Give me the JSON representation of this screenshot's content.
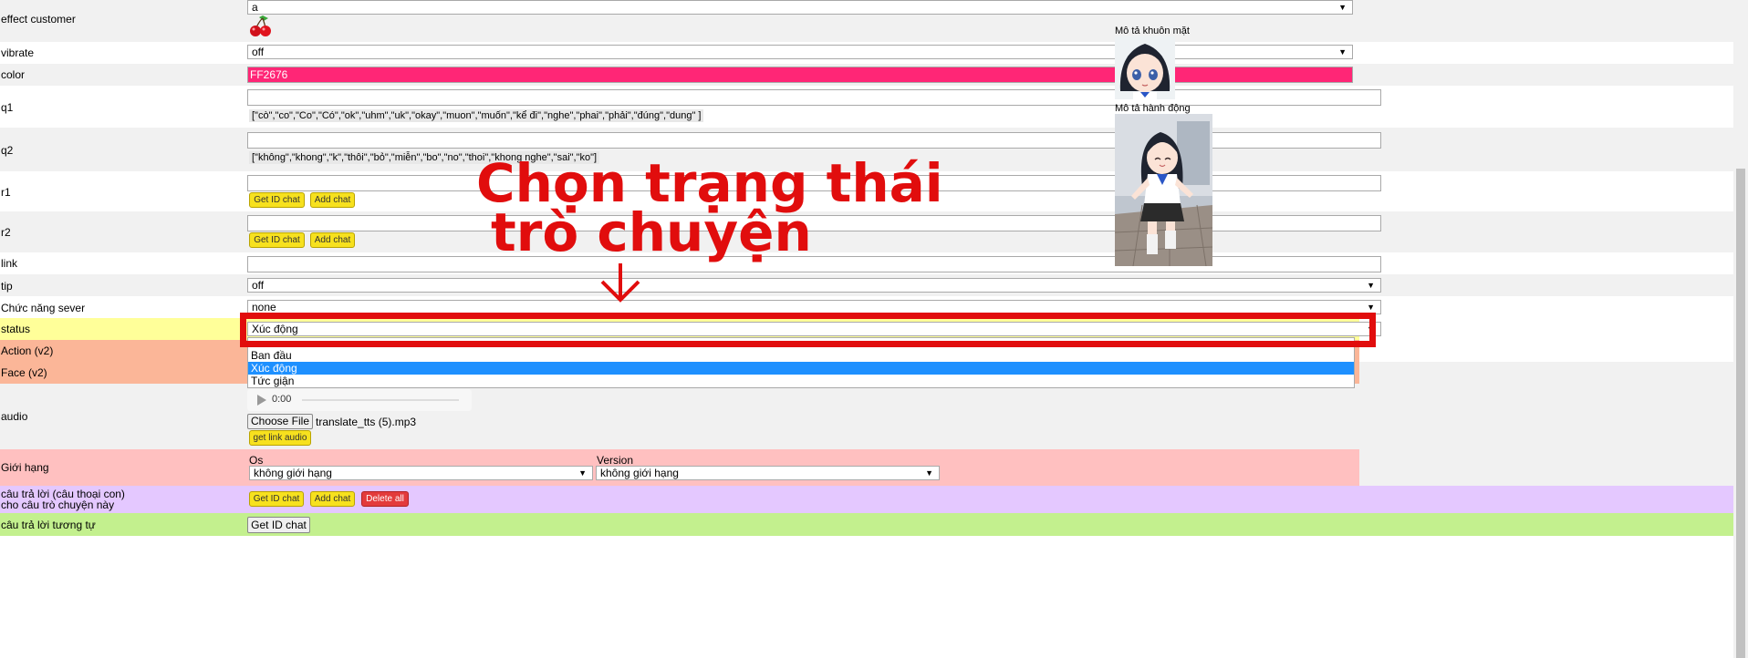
{
  "rows": {
    "effect_customer": {
      "label": "effect customer",
      "value": "a",
      "icon": "cherry-icon"
    },
    "vibrate": {
      "label": "vibrate",
      "value": "off"
    },
    "color": {
      "label": "color",
      "value": "FF2676",
      "swatch": "#ff2676"
    },
    "q1": {
      "label": "q1",
      "hint": "[\"cò\",\"co\",\"Co\",\"Có\",\"ok\",\"uhm\",\"uk\",\"okay\",\"muon\",\"muốn\",\"kể đi\",\"nghe\",\"phai\",\"phải\",\"đúng\",\"dung\" ]"
    },
    "q2": {
      "label": "q2",
      "hint": "[\"không\",\"khong\",\"k\",\"thôi\",\"bỏ\",\"miễn\",\"bo\",\"no\",\"thoi\",\"khong nghe\",\"sai\",\"ko\"]"
    },
    "r1": {
      "label": "r1"
    },
    "r2": {
      "label": "r2"
    },
    "link": {
      "label": "link"
    },
    "tip": {
      "label": "tip",
      "value": "off"
    },
    "server": {
      "label": "Chức năng sever",
      "value": "none"
    },
    "status": {
      "label": "status",
      "value": "Xúc động",
      "options": [
        "Ban đầu",
        "Xúc động",
        "Tức giận"
      ]
    },
    "action": {
      "label": "Action (v2)"
    },
    "face": {
      "label": "Face (v2)"
    },
    "audio": {
      "label": "audio",
      "time": "0:00",
      "choose": "Choose File",
      "filename": "translate_tts (5).mp3",
      "get_link": "get link audio"
    },
    "limit": {
      "label": "Giới hạng",
      "os_label": "Os",
      "os_value": "không giới hạng",
      "version_label": "Version",
      "version_value": "không giới hạng"
    },
    "answer": {
      "label_1": "câu trả lời (câu thoại con)",
      "label_2": "cho câu trò chuyện này"
    },
    "similar": {
      "label": "câu trả lời tương tự",
      "button": "Get ID chat"
    }
  },
  "buttons": {
    "get_id": "Get ID chat",
    "add": "Add chat",
    "delete_all": "Delete all"
  },
  "side": {
    "face_title": "Mô tả khuôn mặt",
    "action_title": "Mô tả hành động"
  },
  "annotation": {
    "line1": "Chọn trạng thái",
    "line2": "trò chuyện"
  },
  "colors": {
    "status_row": "#ffff99",
    "action_row": "#fbb698",
    "limit_row": "#ffc0c0",
    "answer_row": "#e4c8ff",
    "similar_row": "#c3f08e",
    "highlight": "#e10d0d",
    "option_selected": "#1e90ff"
  }
}
